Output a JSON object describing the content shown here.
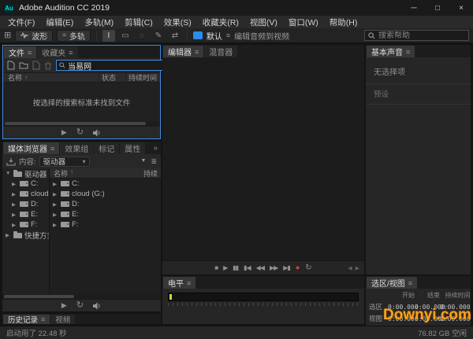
{
  "window": {
    "title": "Adobe Audition CC 2019",
    "app_icon_text": "Au",
    "controls": {
      "minimize": "─",
      "maximize": "□",
      "close": "×"
    }
  },
  "glyphs": {
    "burger": "≡",
    "sort_up": "↑",
    "chevron_right": "▶",
    "chevron_down": "▼",
    "overflow": "»",
    "dropdown_caret": "▾",
    "clear": "×",
    "workspace_grid": "⊞",
    "multitrack_bars": "≡",
    "play": "▶",
    "loop": "↻",
    "filter": "▼",
    "list": "≣",
    "scroll_left": "◀",
    "scroll_right": "▶"
  },
  "menu": {
    "items": [
      "文件(F)",
      "编辑(E)",
      "多轨(M)",
      "剪辑(C)",
      "效果(S)",
      "收藏夹(R)",
      "视图(V)",
      "窗口(W)",
      "帮助(H)"
    ]
  },
  "toolbar": {
    "waveform_label": "波形",
    "multitrack_label": "多轨",
    "workspace_default": "默认",
    "workspace_alt": "编辑音频到视频",
    "search_placeholder": "搜索帮助",
    "tools": [
      {
        "name": "time-selection-tool",
        "glyph": "I"
      },
      {
        "name": "marquee-tool",
        "glyph": "▭"
      },
      {
        "name": "lasso-tool",
        "glyph": "◌"
      },
      {
        "name": "paintbrush-tool",
        "glyph": "✎"
      },
      {
        "name": "slip-tool",
        "glyph": "⇄"
      }
    ]
  },
  "files_panel": {
    "tab_files": "文件",
    "tab_favorites": "收藏夹",
    "search_value": "当易网",
    "columns": {
      "name": "名称",
      "status": "状态",
      "duration": "持续时间"
    },
    "empty_message": "按选择的搜索标准未找到文件"
  },
  "media_browser": {
    "tab_media": "媒体浏览器",
    "tab_effects": "效果组",
    "tab_markers": "标记",
    "tab_properties": "属性",
    "content_label": "内容:",
    "content_value": "驱动器",
    "header_name": "名称",
    "header_duration": "持续",
    "tree_root": "驱动器",
    "tree_shortcuts": "快捷方式",
    "drives": [
      "C:",
      "cloud (G:)",
      "D:",
      "E:",
      "F:"
    ]
  },
  "history_panel": {
    "tab_history": "历史记录",
    "tab_video": "视频"
  },
  "editor": {
    "tab_editor": "编辑器",
    "tab_mixer": "混音器",
    "transport": [
      {
        "name": "stop",
        "glyph": "■"
      },
      {
        "name": "play",
        "glyph": "▶"
      },
      {
        "name": "pause",
        "glyph": "▮▮"
      },
      {
        "name": "skip-back",
        "glyph": "▮◀"
      },
      {
        "name": "rewind",
        "glyph": "◀◀"
      },
      {
        "name": "fast-forward",
        "glyph": "▶▶"
      },
      {
        "name": "skip-forward",
        "glyph": "▶▮"
      },
      {
        "name": "record",
        "glyph": "●"
      },
      {
        "name": "loop",
        "glyph": "↻"
      }
    ]
  },
  "levels_panel": {
    "tab": "电平"
  },
  "essential_sound": {
    "tab": "基本声音",
    "no_selection": "无选择项",
    "preset_label": "预设"
  },
  "selection_view": {
    "tab": "选区/视图",
    "columns": [
      "开始",
      "结束",
      "持续时间"
    ],
    "rows": [
      {
        "label": "选区",
        "values": [
          "0:00.000",
          "0:00.000",
          "0:00.000"
        ]
      },
      {
        "label": "视图",
        "values": [
          "0:00.000",
          "0:00.000",
          "0:00.000"
        ]
      }
    ]
  },
  "status_bar": {
    "left": "启动用了 22.48 秒",
    "right": "76.82 GB 空闲"
  },
  "watermark": {
    "text": "Downyi.com",
    "color": "#ffa21f"
  },
  "colors": {
    "focus_blue": "#3f8ae0",
    "record_red": "#d84339",
    "meter_yellow": "#d6d23c",
    "app_icon_teal": "#00e4bb"
  }
}
